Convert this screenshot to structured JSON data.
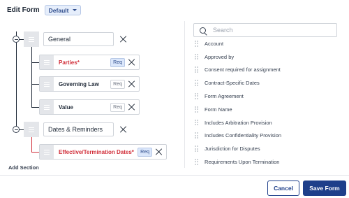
{
  "header": {
    "title": "Edit Form",
    "dropdown_value": "Default"
  },
  "sections": [
    {
      "name": "General",
      "fields": [
        {
          "name": "Parties",
          "required_marker": "*",
          "badge": "Req"
        },
        {
          "name": "Governing Law",
          "required_marker": "",
          "badge": "Req"
        },
        {
          "name": "Value",
          "required_marker": "",
          "badge": "Req"
        }
      ]
    },
    {
      "name": "Dates & Reminders",
      "fields": [
        {
          "name": "Effective/Termination Dates",
          "required_marker": "*",
          "badge": "Req"
        }
      ]
    }
  ],
  "add_section_label": "Add Section",
  "search": {
    "placeholder": "Search"
  },
  "available_fields": [
    "Account",
    "Approved by",
    "Consent required for assignment",
    "Contract-Specific Dates",
    "Form Agreement",
    "Form Name",
    "Includes Arbitration Provision",
    "Includes Confidentiality Provision",
    "Jurisdiction for Disputes",
    "Requirements Upon Termination"
  ],
  "footer": {
    "cancel_label": "Cancel",
    "save_label": "Save Form"
  },
  "colors": {
    "accent": "#1e3f8a",
    "required": "#d12f3a",
    "badge_active_bg": "#dbe7fb"
  }
}
